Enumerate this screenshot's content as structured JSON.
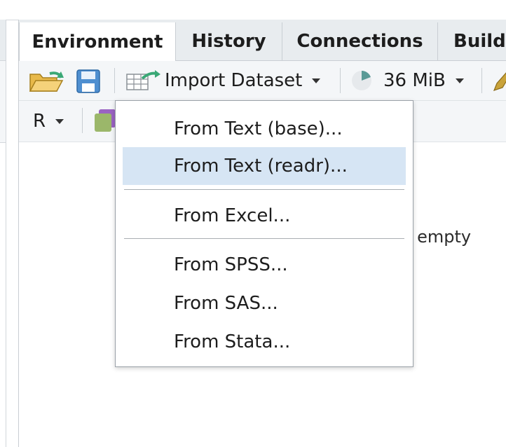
{
  "tabs": [
    {
      "label": "Environment",
      "active": true
    },
    {
      "label": "History",
      "active": false
    },
    {
      "label": "Connections",
      "active": false
    },
    {
      "label": "Build",
      "active": false
    }
  ],
  "toolbar": {
    "open_icon": "folder-open-icon",
    "save_icon": "floppy-save-icon",
    "import_label": "Import Dataset",
    "memory_label": "36 MiB",
    "broom_icon": "broom-icon",
    "language_label": "R"
  },
  "environment": {
    "empty_message": "s empty"
  },
  "import_menu": {
    "items": [
      {
        "label": "From Text (base)..."
      },
      {
        "label": "From Text (readr)...",
        "hover": true
      },
      {
        "label": "From Excel..."
      },
      {
        "label": "From SPSS..."
      },
      {
        "label": "From SAS..."
      },
      {
        "label": "From Stata..."
      }
    ]
  },
  "colors": {
    "tab_bar_bg": "#e8ecef",
    "toolbar_bg": "#f4f6f8",
    "menu_hover": "#d6e5f4",
    "accent_green": "#3aa876"
  }
}
